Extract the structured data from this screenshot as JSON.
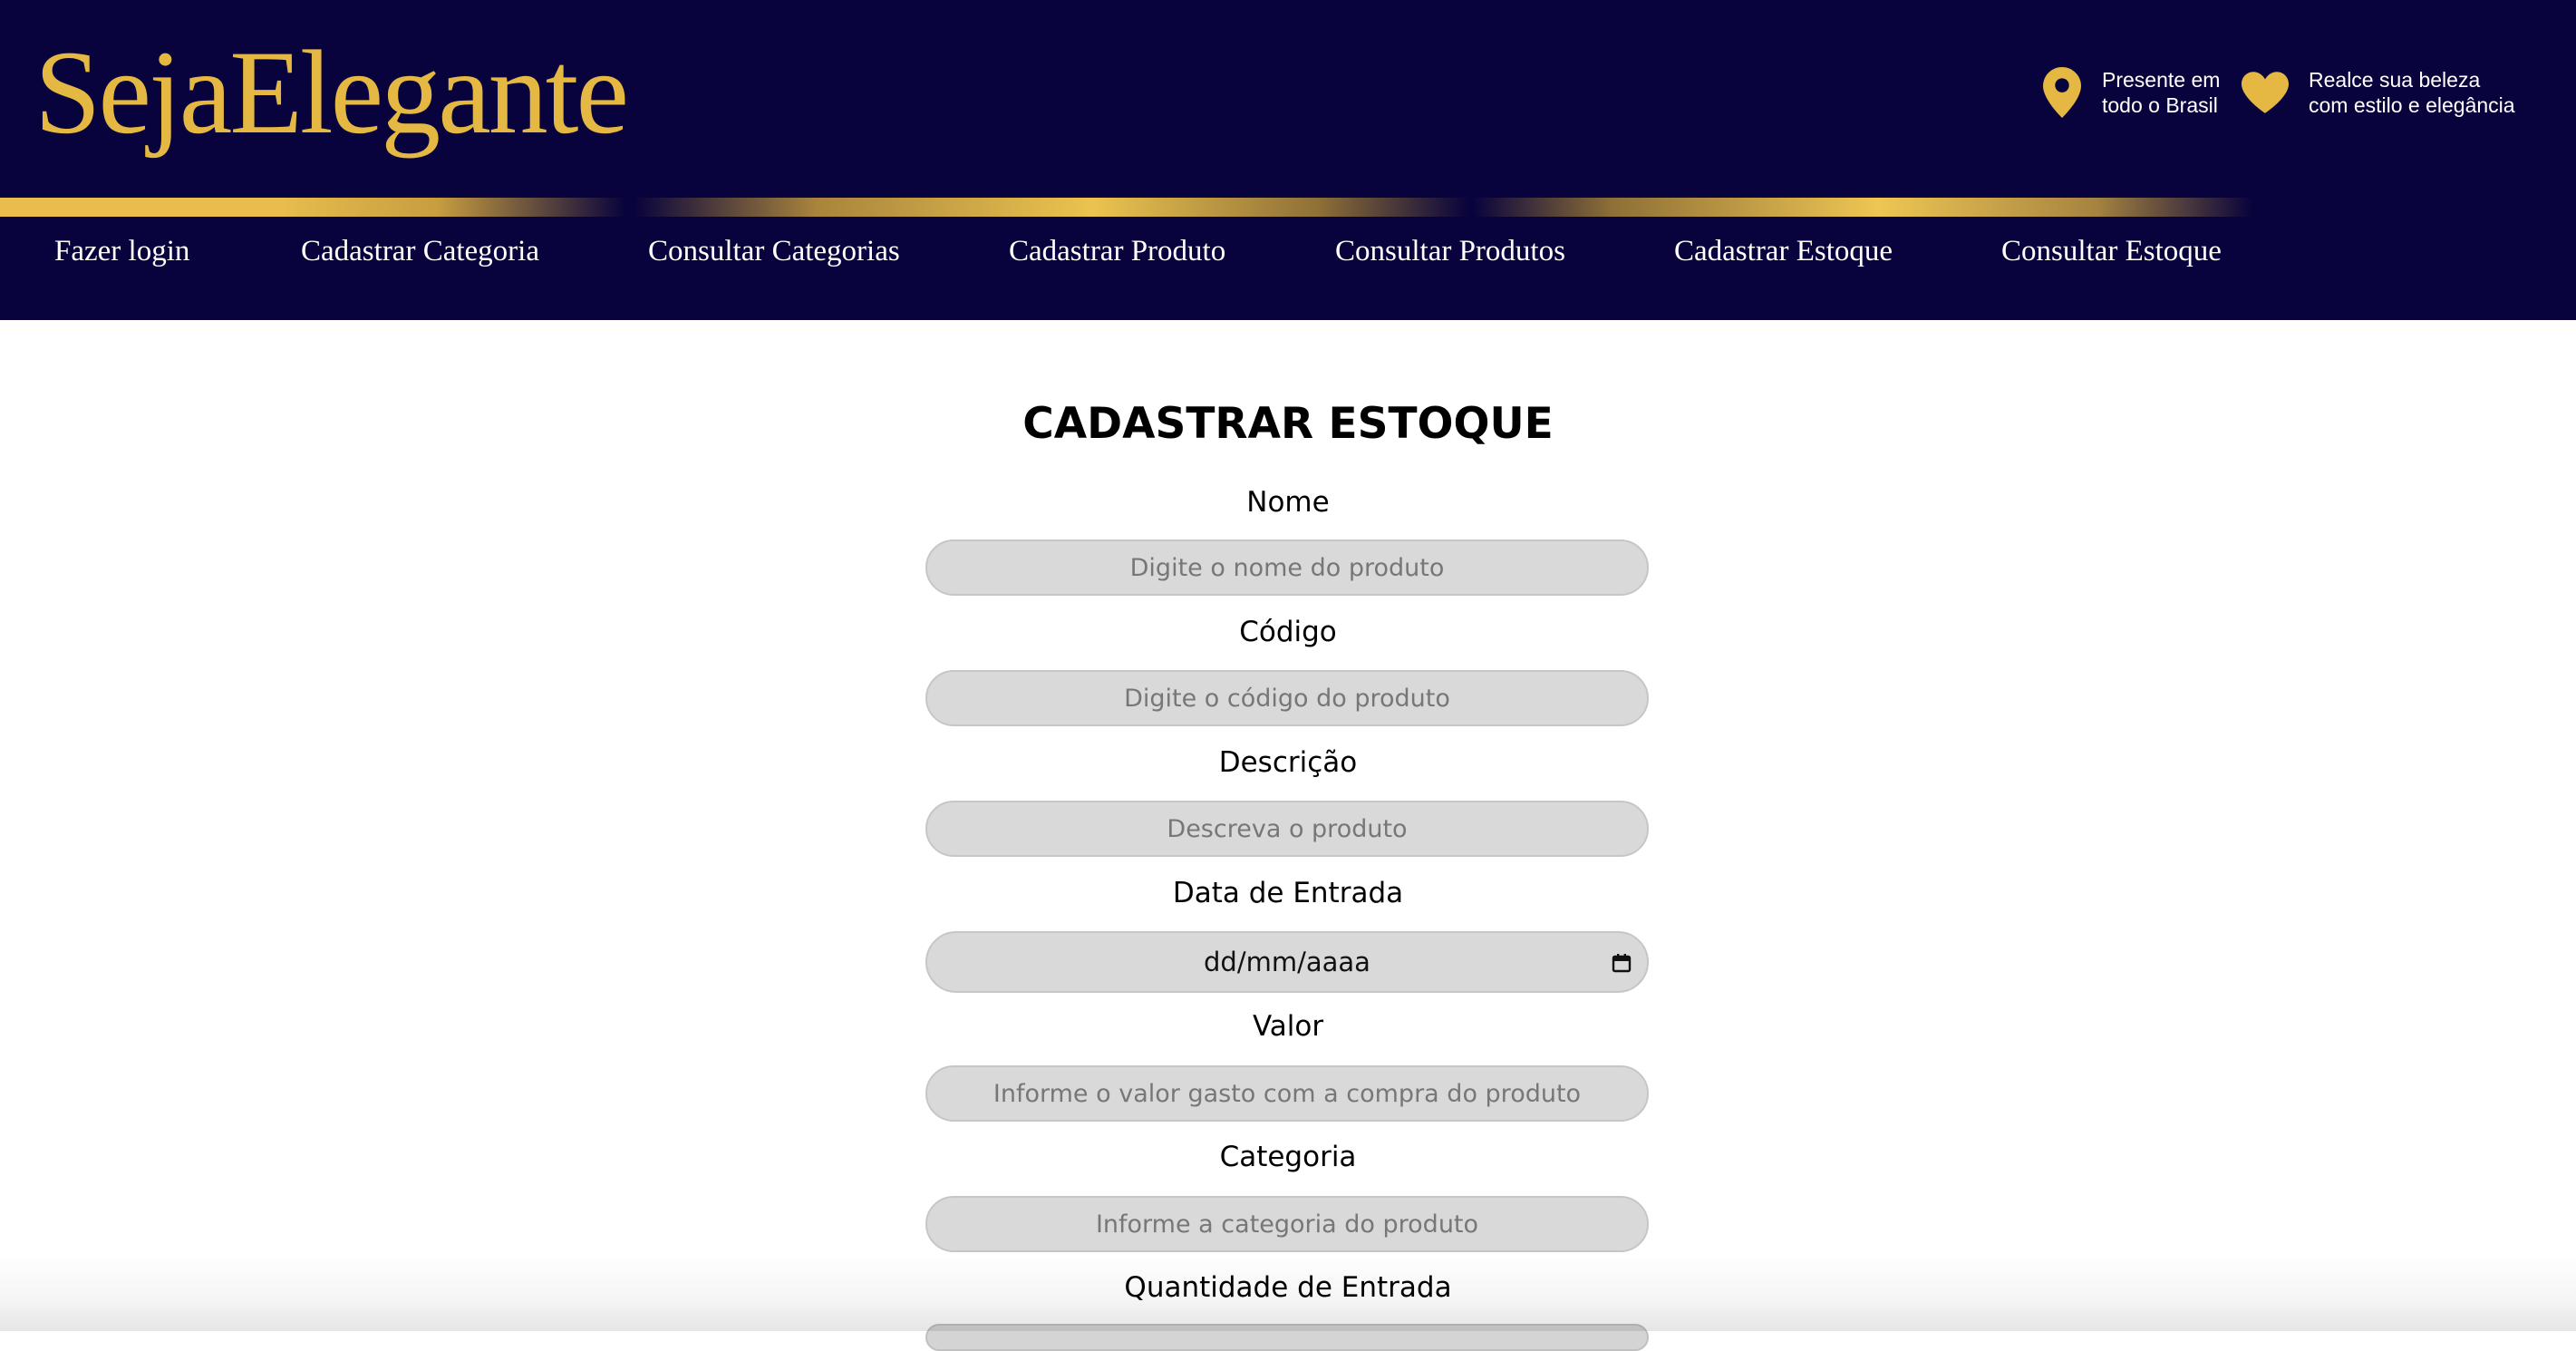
{
  "brand": {
    "logo_text": "SejaElegante",
    "gold": "#e5b844",
    "navy": "#08033c"
  },
  "header_info": [
    {
      "icon": "map-pin-icon",
      "line1": "Presente em",
      "line2": "todo o Brasil"
    },
    {
      "icon": "heart-icon",
      "line1": "Realce sua beleza",
      "line2": "com estilo e elegância"
    }
  ],
  "nav": {
    "items": [
      "Fazer login",
      "Cadastrar Categoria",
      "Consultar Categorias",
      "Cadastrar Produto",
      "Consultar Produtos",
      "Cadastrar Estoque",
      "Consultar Estoque"
    ]
  },
  "form": {
    "title": "CADASTRAR ESTOQUE",
    "fields": [
      {
        "label": "Nome",
        "placeholder": "Digite o nome do produto"
      },
      {
        "label": "Código",
        "placeholder": "Digite o código do produto"
      },
      {
        "label": "Descrição",
        "placeholder": "Descreva o produto"
      },
      {
        "label": "Data de Entrada",
        "value": "dd/mm/aaaa"
      },
      {
        "label": "Valor",
        "placeholder": "Informe o valor gasto com a compra do produto"
      },
      {
        "label": "Categoria",
        "placeholder": "Informe a categoria do produto"
      },
      {
        "label": "Quantidade de Entrada"
      }
    ]
  }
}
